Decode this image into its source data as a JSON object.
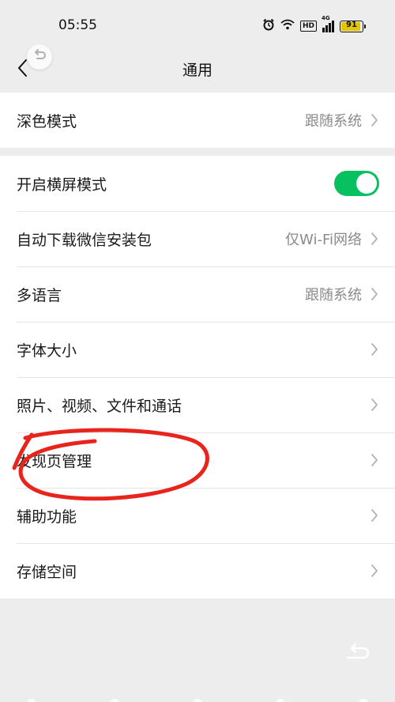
{
  "status_bar": {
    "time": "05:55",
    "hd_label": "HD",
    "network_label": "4G",
    "battery": "91",
    "battery_level": 0.91,
    "icons": [
      "alarm-icon",
      "wifi-icon",
      "hd-icon",
      "signal-icon",
      "battery-icon"
    ]
  },
  "nav": {
    "title": "通用",
    "back_icon": "chevron-left-icon",
    "float_icon": "return-arrow-icon"
  },
  "groups": [
    {
      "items": [
        {
          "label": "深色模式",
          "value": "跟随系统",
          "control": "chevron"
        }
      ]
    },
    {
      "items": [
        {
          "label": "开启横屏模式",
          "value": "",
          "control": "toggle",
          "toggle_on": true
        },
        {
          "label": "自动下载微信安装包",
          "value": "仅Wi-Fi网络",
          "control": "chevron"
        },
        {
          "label": "多语言",
          "value": "跟随系统",
          "control": "chevron"
        },
        {
          "label": "字体大小",
          "value": "",
          "control": "chevron"
        },
        {
          "label": "照片、视频、文件和通话",
          "value": "",
          "control": "chevron"
        },
        {
          "label": "发现页管理",
          "value": "",
          "control": "chevron"
        },
        {
          "label": "辅助功能",
          "value": "",
          "control": "chevron"
        },
        {
          "label": "存储空间",
          "value": "",
          "control": "chevron"
        }
      ]
    }
  ],
  "colors": {
    "background": "#ededed",
    "card": "#ffffff",
    "accent_green": "#07c160",
    "annotation_red": "#e8251d",
    "secondary_text": "#8a8a8a"
  }
}
